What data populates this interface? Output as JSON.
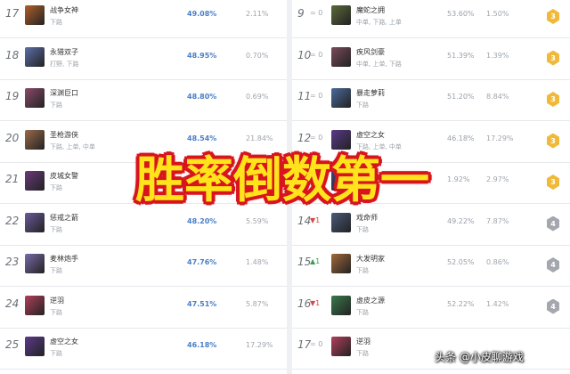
{
  "left": [
    {
      "rank": "17",
      "name": "战争女神",
      "role": "下路",
      "win": "49.08%",
      "pick": "2.11%",
      "color": "#b0602a"
    },
    {
      "rank": "18",
      "name": "永猎双子",
      "role": "打野, 下路",
      "win": "48.95%",
      "pick": "0.70%",
      "color": "#5c6fa8"
    },
    {
      "rank": "19",
      "name": "深渊巨口",
      "role": "下路",
      "win": "48.80%",
      "pick": "0.69%",
      "color": "#8a4a6a"
    },
    {
      "rank": "20",
      "name": "圣枪游侠",
      "role": "下路, 上单, 中单",
      "win": "48.54%",
      "pick": "21.84%",
      "color": "#9a6b4a"
    },
    {
      "rank": "21",
      "name": "皮城女警",
      "role": "下路",
      "win": "",
      "pick": "",
      "color": "#6a3a7a"
    },
    {
      "rank": "22",
      "name": "惩戒之箭",
      "role": "下路",
      "win": "48.20%",
      "pick": "5.59%",
      "color": "#6a5a9a"
    },
    {
      "rank": "23",
      "name": "麦林炮手",
      "role": "下路",
      "win": "47.76%",
      "pick": "1.48%",
      "color": "#7a6aa8"
    },
    {
      "rank": "24",
      "name": "逆羽",
      "role": "下路",
      "win": "47.51%",
      "pick": "5.87%",
      "color": "#b0405a"
    },
    {
      "rank": "25",
      "name": "虚空之女",
      "role": "下路",
      "win": "46.18%",
      "pick": "17.29%",
      "color": "#5a3a8a"
    }
  ],
  "right": [
    {
      "rank": "9",
      "chg": "= 0",
      "chgType": "same",
      "name": "魔蛇之拥",
      "role": "中单, 下路, 上单",
      "win": "53.60%",
      "pick": "1.50%",
      "tier": "3",
      "color": "#5a6a3a"
    },
    {
      "rank": "10",
      "chg": "= 0",
      "chgType": "same",
      "name": "疾风剑豪",
      "role": "中单, 上单, 下路",
      "win": "51.39%",
      "pick": "1.39%",
      "tier": "3",
      "color": "#7a4a5a"
    },
    {
      "rank": "11",
      "chg": "= 0",
      "chgType": "same",
      "name": "暴走萝莉",
      "role": "下路",
      "win": "51.20%",
      "pick": "8.84%",
      "tier": "3",
      "color": "#4a6a9a"
    },
    {
      "rank": "12",
      "chg": "= 0",
      "chgType": "same",
      "name": "虚空之女",
      "role": "下路, 上单, 中单",
      "win": "46.18%",
      "pick": "17.29%",
      "tier": "3",
      "color": "#5a3a8a"
    },
    {
      "rank": "13",
      "chg": "= 0",
      "chgType": "same",
      "name": "",
      "role": "",
      "win": "1.92%",
      "pick": "2.97%",
      "tier": "3",
      "color": "#3a4a7a"
    },
    {
      "rank": "14",
      "chg": "▼1",
      "chgType": "down",
      "name": "戏命师",
      "role": "下路",
      "win": "49.22%",
      "pick": "7.87%",
      "tier": "4",
      "color": "#4a5a7a"
    },
    {
      "rank": "15",
      "chg": "▲1",
      "chgType": "up",
      "name": "大发明家",
      "role": "下路",
      "win": "52.05%",
      "pick": "0.86%",
      "tier": "4",
      "color": "#a06a3a"
    },
    {
      "rank": "16",
      "chg": "▼1",
      "chgType": "down",
      "name": "虚皮之源",
      "role": "下路",
      "win": "52.22%",
      "pick": "1.42%",
      "tier": "4",
      "color": "#3a7a4a"
    },
    {
      "rank": "17",
      "chg": "= 0",
      "chgType": "same",
      "name": "逆羽",
      "role": "下路",
      "win": "",
      "pick": "",
      "tier": "",
      "color": "#b0405a"
    }
  ],
  "overlay_text": "胜率倒数第一",
  "watermark": "头条 @小皮聊游戏"
}
